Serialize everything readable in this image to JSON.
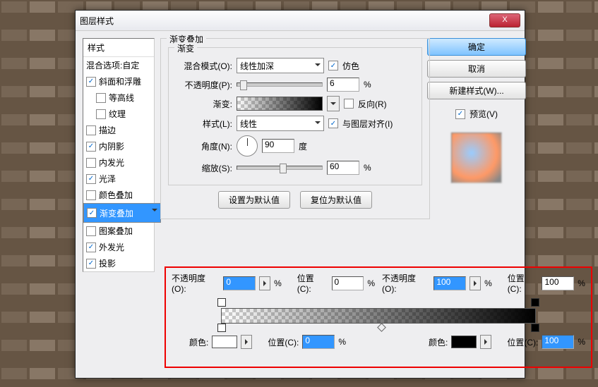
{
  "window": {
    "title": "图层样式",
    "close": "X"
  },
  "styles": {
    "header": "样式",
    "blend": "混合选项:自定",
    "items": [
      {
        "label": "斜面和浮雕",
        "checked": true
      },
      {
        "label": "等高线",
        "checked": false
      },
      {
        "label": "纹理",
        "checked": false
      },
      {
        "label": "描边",
        "checked": false
      },
      {
        "label": "内阴影",
        "checked": true
      },
      {
        "label": "内发光",
        "checked": false
      },
      {
        "label": "光泽",
        "checked": true
      },
      {
        "label": "颜色叠加",
        "checked": false
      },
      {
        "label": "渐变叠加",
        "checked": true,
        "selected": true
      },
      {
        "label": "图案叠加",
        "checked": false
      },
      {
        "label": "外发光",
        "checked": true
      },
      {
        "label": "投影",
        "checked": true
      }
    ]
  },
  "grad": {
    "title": "渐变叠加",
    "subtitle": "渐变",
    "blendMode": {
      "label": "混合模式(O):",
      "value": "线性加深"
    },
    "dither": {
      "label": "仿色",
      "checked": true
    },
    "opacity": {
      "label": "不透明度(P):",
      "value": "6",
      "unit": "%"
    },
    "gradient": {
      "label": "渐变:"
    },
    "reverse": {
      "label": "反向(R)",
      "checked": false
    },
    "style": {
      "label": "样式(L):",
      "value": "线性"
    },
    "align": {
      "label": "与图层对齐(I)",
      "checked": true
    },
    "angle": {
      "label": "角度(N):",
      "value": "90",
      "unit": "度"
    },
    "scale": {
      "label": "缩放(S):",
      "value": "60",
      "unit": "%"
    },
    "btn1": "设置为默认值",
    "btn2": "复位为默认值"
  },
  "editor": {
    "opL": {
      "label": "不透明度(O):",
      "value": "0",
      "unit": "%"
    },
    "posL": {
      "label": "位置(C):",
      "value": "0",
      "unit": "%"
    },
    "opR": {
      "label": "不透明度(O):",
      "value": "100",
      "unit": "%"
    },
    "posR": {
      "label": "位置(C):",
      "value": "100",
      "unit": "%"
    },
    "colL": {
      "label": "颜色:"
    },
    "posBL": {
      "label": "位置(C):",
      "value": "0",
      "unit": "%"
    },
    "colR": {
      "label": "颜色:"
    },
    "posBR": {
      "label": "位置(C):",
      "value": "100",
      "unit": "%"
    }
  },
  "right": {
    "ok": "确定",
    "cancel": "取消",
    "newStyle": "新建样式(W)...",
    "preview": {
      "label": "预览(V)",
      "checked": true
    }
  }
}
